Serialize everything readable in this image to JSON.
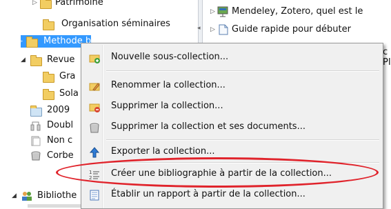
{
  "tree": {
    "items": [
      {
        "label": "Patrimoine",
        "icon": "folder-icon"
      },
      {
        "label": "Organisation séminaires",
        "icon": "folder-icon"
      },
      {
        "label": "Methode biblio",
        "icon": "folder-icon"
      },
      {
        "label": "Revue",
        "icon": "folder-icon"
      },
      {
        "label": "Gra",
        "icon": "folder-icon"
      },
      {
        "label": "Sola",
        "icon": "folder-icon"
      },
      {
        "label": "2009",
        "icon": "calendar-folder-icon"
      },
      {
        "label": "Doubl",
        "icon": "duplicates-icon"
      },
      {
        "label": "Non c",
        "icon": "unfiled-icon"
      },
      {
        "label": "Corbe",
        "icon": "trash-icon"
      },
      {
        "label": "Bibliothe",
        "icon": "group-library-icon"
      }
    ]
  },
  "items_list": [
    {
      "title": "Mendeley, Zotero, quel est le",
      "icon": "presentation-icon"
    },
    {
      "title": "Guide rapide pour débuter",
      "icon": "document-icon"
    },
    {
      "title": "c",
      "icon": ""
    },
    {
      "title": "PIP",
      "icon": ""
    }
  ],
  "context_menu": {
    "items": [
      {
        "label": "Nouvelle sous-collection...",
        "icon": "new-subcollection-icon"
      },
      {
        "label": "Renommer la collection...",
        "icon": "rename-icon"
      },
      {
        "label": "Supprimer la collection...",
        "icon": "delete-collection-icon"
      },
      {
        "label": "Supprimer la collection et ses documents...",
        "icon": "delete-collection-docs-icon"
      },
      {
        "label": "Exporter la collection...",
        "icon": "export-icon"
      },
      {
        "label": "Créer une bibliographie à partir de la collection...",
        "icon": "bibliography-icon"
      },
      {
        "label": "Établir un rapport à partir de la collection...",
        "icon": "report-icon"
      }
    ]
  },
  "colors": {
    "selected_row": "#3399ff",
    "annotation_ellipse": "#e0232b",
    "menu_bg": "#f0f0f0"
  }
}
